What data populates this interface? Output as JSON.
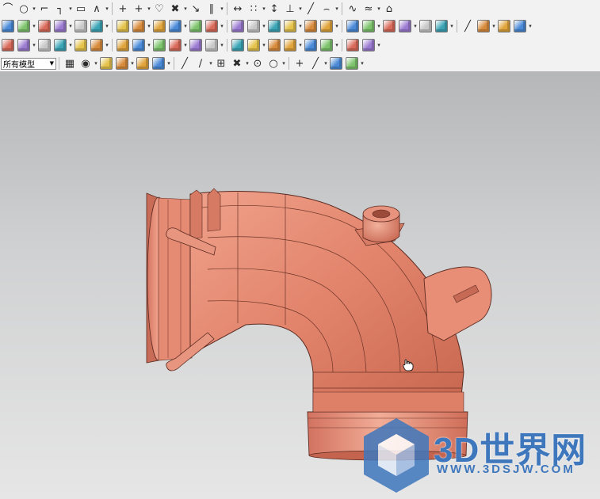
{
  "toolbar": {
    "filter_select_value": "所有模型",
    "row1_icons": [
      "arc-icon",
      "circle-icon",
      "fillet-icon",
      "corner-icon",
      "rectangle-icon",
      "polyline-icon",
      "plus-icon",
      "point-icon",
      "sketch-curve-icon",
      "trim-icon",
      "extend-icon",
      "offset-icon",
      "mirror-icon",
      "pattern-icon",
      "dimension-icon",
      "constraint-icon",
      "line-icon",
      "arc3-icon",
      "spline-icon",
      "studio-spline-icon",
      "fit-curve-icon"
    ],
    "row2_icons": [
      "block-icon",
      "cylinder-icon",
      "extrude-icon",
      "revolve-icon",
      "hole-icon",
      "boss-icon",
      "pocket-icon",
      "pad-icon",
      "slot-icon",
      "groove-icon",
      "chamfer-icon",
      "edge-blend-icon",
      "shell-icon",
      "draft-icon",
      "trim-body-icon",
      "split-body-icon",
      "unite-icon",
      "subtract-icon",
      "intersect-icon",
      "sew-icon",
      "patch-icon",
      "offset-face-icon",
      "measure-icon",
      "analysis-icon",
      "line-tool-icon",
      "sweep-icon",
      "thicken-icon",
      "sheet-icon"
    ],
    "row3_icons": [
      "surface-icon",
      "ruled-icon",
      "through-curves-icon",
      "mesh-icon",
      "swept-icon",
      "n-sided-icon",
      "bridge-icon",
      "extension-icon",
      "law-extension-icon",
      "trim-sheet-icon",
      "face-blend-icon",
      "styled-blend-icon",
      "x-form-icon",
      "i-form-icon",
      "offset-surface-icon",
      "global-shaping-icon",
      "enlarge-icon",
      "reverse-normal-icon",
      "view-section-icon",
      "deviation-icon"
    ],
    "row4_icons": [
      "selection-filter-icon",
      "snap-point-icon",
      "select-all-icon",
      "box-select-icon",
      "shaded-icon",
      "wireframe-icon",
      "end-point-icon",
      "mid-point-icon",
      "control-point-icon",
      "intersection-icon",
      "arc-center-icon",
      "quadrant-icon",
      "existing-point-icon",
      "point-on-curve-icon",
      "layer-icon",
      "workspace-icon"
    ]
  },
  "viewport": {
    "model_color": "#e2836b",
    "background_top": "#b5b7b8",
    "background_bottom": "#e6e6e6"
  },
  "watermark": {
    "logo_text": "3D世界网",
    "url_text": "WWW.3DSJW.COM",
    "color": "#3f77bd"
  }
}
